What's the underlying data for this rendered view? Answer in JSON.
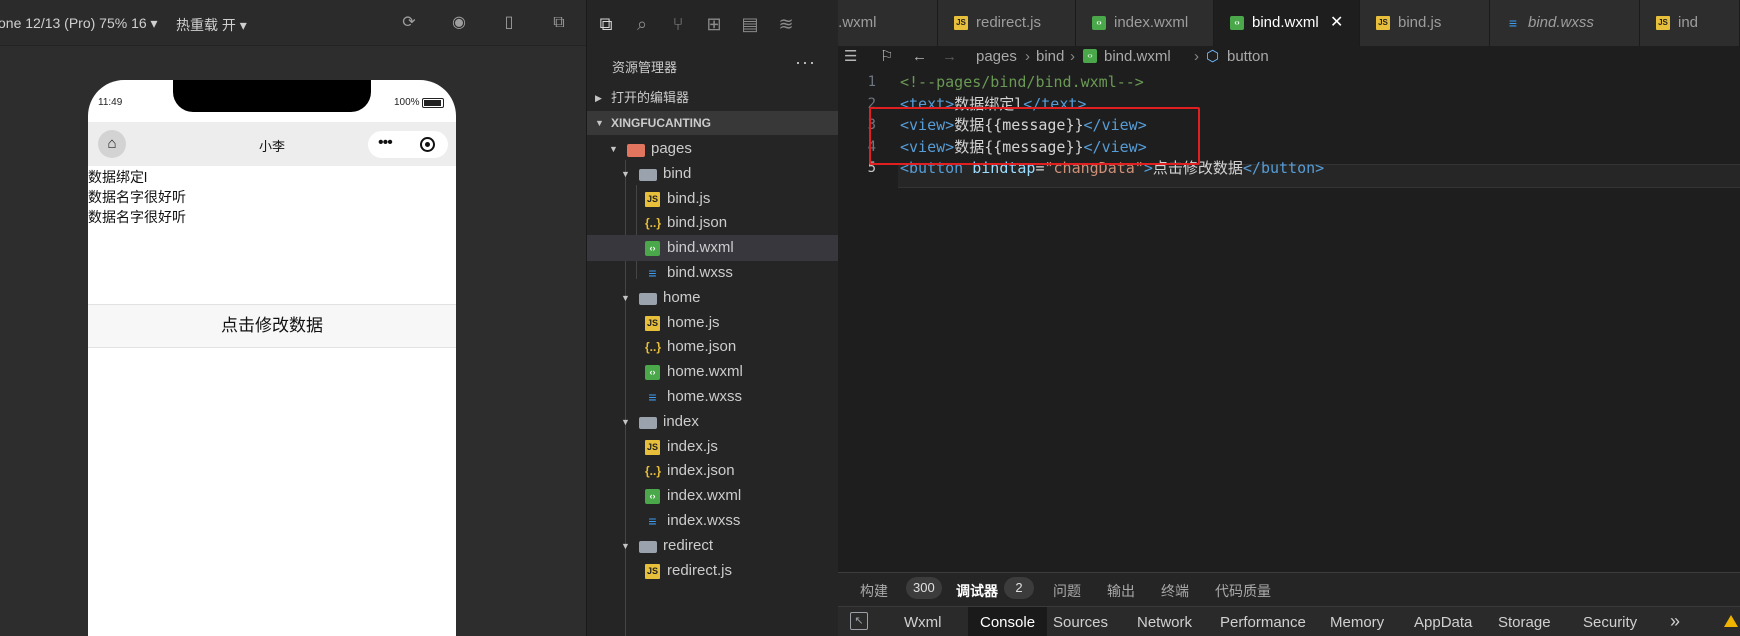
{
  "simulator": {
    "device_label": "one 12/13 (Pro) 75% 16 ▾",
    "hot_reload_label": "热重载 开 ▾",
    "status_time": "11:49",
    "status_battery": "100%",
    "nav_title": "小李",
    "page": {
      "lines": [
        "数据绑定l",
        "数据名字很好听",
        "数据名字很好听"
      ],
      "button_label": "点击修改数据"
    }
  },
  "explorer": {
    "title": "资源管理器",
    "more": "···",
    "open_editors": "打开的编辑器",
    "project": "XINGFUCANTING",
    "tree": [
      {
        "label": "pages",
        "kind": "folder-pages",
        "depth": 0
      },
      {
        "label": "bind",
        "kind": "folder",
        "depth": 1
      },
      {
        "label": "bind.js",
        "kind": "js",
        "depth": 2
      },
      {
        "label": "bind.json",
        "kind": "json",
        "depth": 2
      },
      {
        "label": "bind.wxml",
        "kind": "wxml",
        "depth": 2,
        "selected": true
      },
      {
        "label": "bind.wxss",
        "kind": "wxss",
        "depth": 2
      },
      {
        "label": "home",
        "kind": "folder",
        "depth": 1
      },
      {
        "label": "home.js",
        "kind": "js",
        "depth": 2
      },
      {
        "label": "home.json",
        "kind": "json",
        "depth": 2
      },
      {
        "label": "home.wxml",
        "kind": "wxml",
        "depth": 2
      },
      {
        "label": "home.wxss",
        "kind": "wxss",
        "depth": 2
      },
      {
        "label": "index",
        "kind": "folder",
        "depth": 1
      },
      {
        "label": "index.js",
        "kind": "js",
        "depth": 2
      },
      {
        "label": "index.json",
        "kind": "json",
        "depth": 2
      },
      {
        "label": "index.wxml",
        "kind": "wxml",
        "depth": 2
      },
      {
        "label": "index.wxss",
        "kind": "wxss",
        "depth": 2
      },
      {
        "label": "redirect",
        "kind": "folder",
        "depth": 1
      },
      {
        "label": "redirect.js",
        "kind": "js",
        "depth": 2
      }
    ]
  },
  "editor": {
    "tabs": [
      {
        "label": "t.wxml",
        "kind": "none"
      },
      {
        "label": "redirect.js",
        "kind": "js"
      },
      {
        "label": "index.wxml",
        "kind": "wxml"
      },
      {
        "label": "bind.wxml",
        "kind": "wxml",
        "active": true
      },
      {
        "label": "bind.js",
        "kind": "js"
      },
      {
        "label": "bind.wxss",
        "kind": "wxss",
        "italic": true
      },
      {
        "label": "ind",
        "kind": "js"
      }
    ],
    "breadcrumb": [
      "pages",
      "bind",
      "bind.wxml",
      "button"
    ],
    "line_numbers": [
      "1",
      "2",
      "3",
      "4",
      "5"
    ],
    "code": [
      [
        {
          "t": "<!--pages/bind/bind.wxml-->",
          "c": "com"
        }
      ],
      [
        {
          "t": "<text>",
          "c": "tag"
        },
        {
          "t": "数据绑定l",
          "c": "txt"
        },
        {
          "t": "</text>",
          "c": "tag"
        }
      ],
      [
        {
          "t": "<view>",
          "c": "tag"
        },
        {
          "t": "数据{{message}}",
          "c": "txt"
        },
        {
          "t": "</view>",
          "c": "tag"
        }
      ],
      [
        {
          "t": "<view>",
          "c": "tag"
        },
        {
          "t": "数据{{message}}",
          "c": "txt"
        },
        {
          "t": "</view>",
          "c": "tag"
        }
      ],
      [
        {
          "t": "<button ",
          "c": "tag"
        },
        {
          "t": "bindtap",
          "c": "attr"
        },
        {
          "t": "=",
          "c": "txt"
        },
        {
          "t": "\"changData\"",
          "c": "str"
        },
        {
          "t": ">",
          "c": "tag"
        },
        {
          "t": "点击修改数据",
          "c": "txt"
        },
        {
          "t": "</button>",
          "c": "tag"
        }
      ]
    ]
  },
  "panel": {
    "build_label": "构建",
    "build_count": "300",
    "debugger_label": "调试器",
    "debugger_count": "2",
    "issues_label": "问题",
    "output_label": "输出",
    "terminal_label": "终端",
    "quality_label": "代码质量"
  },
  "devtools": {
    "tabs": [
      "Wxml",
      "Console",
      "Sources",
      "Network",
      "Performance",
      "Memory",
      "AppData",
      "Storage",
      "Security"
    ],
    "active": "Console",
    "more": "»"
  },
  "colors": {
    "highlight_box": "#e02020",
    "tag": "#569cd6",
    "comment": "#6a9955",
    "string": "#ce9178",
    "attribute": "#9cdcfe"
  }
}
